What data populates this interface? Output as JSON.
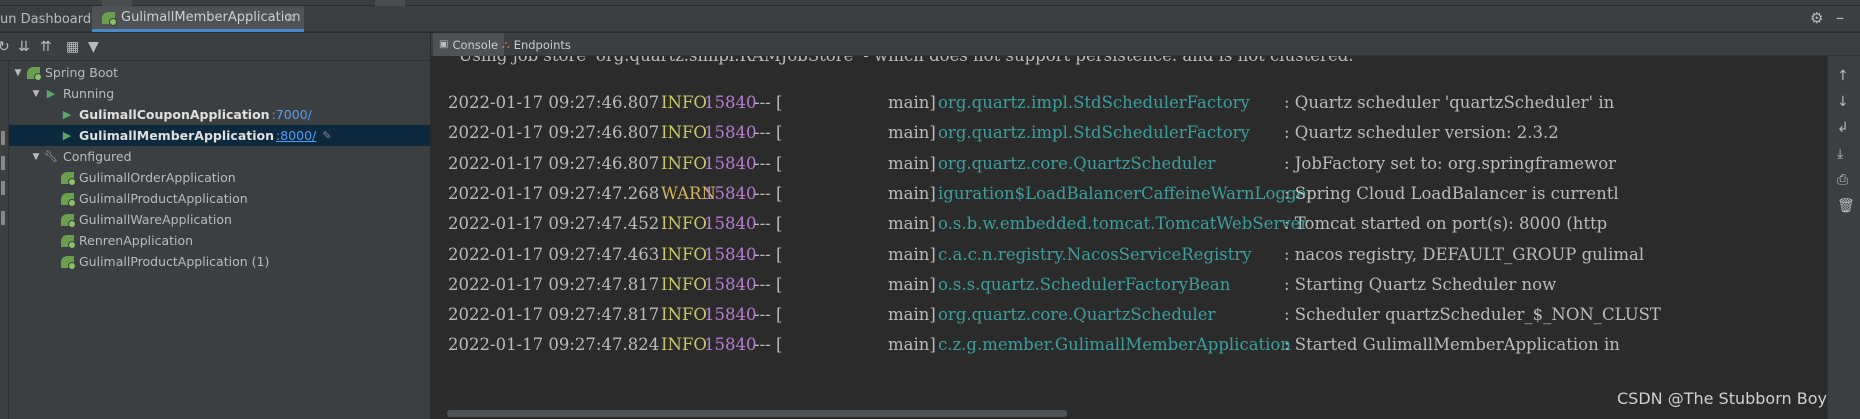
{
  "titlebar": {
    "dashboard_label": "un Dashboard:",
    "active_tab": "GulimallMemberApplication"
  },
  "tree": {
    "root": "Spring Boot",
    "running_group": "Running",
    "running": [
      {
        "name": "GulimallCouponApplication",
        "port": ":7000/"
      },
      {
        "name": "GulimallMemberApplication",
        "port": ":8000/"
      }
    ],
    "configured_group": "Configured",
    "configured": [
      "GulimallOrderApplication",
      "GulimallProductApplication",
      "GulimallWareApplication",
      "RenrenApplication",
      "GulimallProductApplication (1)"
    ]
  },
  "console_tabs": {
    "console": "Console",
    "endpoints": "Endpoints"
  },
  "console": {
    "partial_line": "  Using job store 'org.quartz.simpl.RAMJobStore' - which does not support persistence. and is not clustered.",
    "logs": [
      {
        "ts": "2022-01-17 09:27:46.807",
        "level": "INFO",
        "pid": "15840",
        "sep": "--- [",
        "thread": "main]",
        "logger": "org.quartz.impl.StdSchedulerFactory",
        "msg": ": Quartz scheduler 'quartzScheduler' in"
      },
      {
        "ts": "2022-01-17 09:27:46.807",
        "level": "INFO",
        "pid": "15840",
        "sep": "--- [",
        "thread": "main]",
        "logger": "org.quartz.impl.StdSchedulerFactory",
        "msg": ": Quartz scheduler version: 2.3.2"
      },
      {
        "ts": "2022-01-17 09:27:46.807",
        "level": "INFO",
        "pid": "15840",
        "sep": "--- [",
        "thread": "main]",
        "logger": "org.quartz.core.QuartzScheduler",
        "msg": ": JobFactory set to: org.springframewor"
      },
      {
        "ts": "2022-01-17 09:27:47.268",
        "level": "WARN",
        "pid": "15840",
        "sep": "--- [",
        "thread": "main]",
        "logger": "iguration$LoadBalancerCaffeineWarnLogger",
        "msg": ": Spring Cloud LoadBalancer is currentl"
      },
      {
        "ts": "2022-01-17 09:27:47.452",
        "level": "INFO",
        "pid": "15840",
        "sep": "--- [",
        "thread": "main]",
        "logger": "o.s.b.w.embedded.tomcat.TomcatWebServer",
        "msg": ": Tomcat started on port(s): 8000 (http"
      },
      {
        "ts": "2022-01-17 09:27:47.463",
        "level": "INFO",
        "pid": "15840",
        "sep": "--- [",
        "thread": "main]",
        "logger": "c.a.c.n.registry.NacosServiceRegistry",
        "msg": ": nacos registry, DEFAULT_GROUP gulimal"
      },
      {
        "ts": "2022-01-17 09:27:47.817",
        "level": "INFO",
        "pid": "15840",
        "sep": "--- [",
        "thread": "main]",
        "logger": "o.s.s.quartz.SchedulerFactoryBean",
        "msg": ": Starting Quartz Scheduler now"
      },
      {
        "ts": "2022-01-17 09:27:47.817",
        "level": "INFO",
        "pid": "15840",
        "sep": "--- [",
        "thread": "main]",
        "logger": "org.quartz.core.QuartzScheduler",
        "msg": ": Scheduler quartzScheduler_$_NON_CLUST"
      },
      {
        "ts": "2022-01-17 09:27:47.824",
        "level": "INFO",
        "pid": "15840",
        "sep": "--- [",
        "thread": "main]",
        "logger": "c.z.g.member.GulimallMemberApplication",
        "msg": ": Started GulimallMemberApplication in"
      }
    ]
  },
  "watermark": "CSDN @The Stubborn Boy",
  "colors": {
    "accent": "#4a88c7",
    "selection": "#0d293e",
    "logger": "#3c9f9f",
    "pid": "#b87cd0",
    "info": "#c8c86a"
  }
}
